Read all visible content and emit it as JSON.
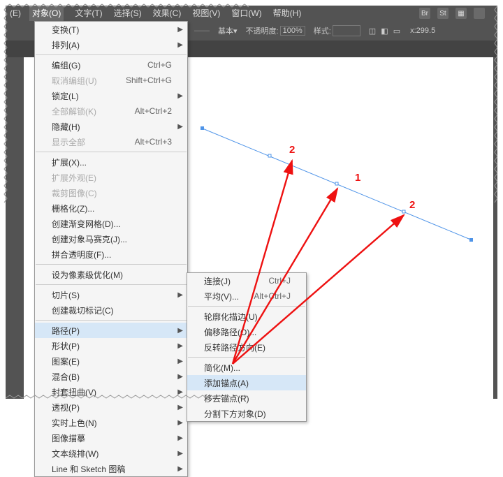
{
  "menubar": {
    "items": [
      "(E)",
      "对象(O)",
      "文字(T)",
      "选择(S)",
      "效果(C)",
      "视图(V)",
      "窗口(W)",
      "帮助(H)"
    ]
  },
  "toolbar": {
    "basic": "基本",
    "opacity_label": "不透明度:",
    "opacity_value": "100%",
    "style_label": "样式:",
    "x_label": "x:",
    "x_value": "299.5"
  },
  "tab": {
    "doc_label": ""
  },
  "object_menu": {
    "items": [
      {
        "label": "变换(T)",
        "sub": true
      },
      {
        "label": "排列(A)",
        "sub": true
      },
      "sep",
      {
        "label": "编组(G)",
        "shortcut": "Ctrl+G"
      },
      {
        "label": "取消编组(U)",
        "shortcut": "Shift+Ctrl+G",
        "disabled": true
      },
      {
        "label": "锁定(L)",
        "sub": true
      },
      {
        "label": "全部解锁(K)",
        "shortcut": "Alt+Ctrl+2",
        "disabled": true
      },
      {
        "label": "隐藏(H)",
        "sub": true
      },
      {
        "label": "显示全部",
        "shortcut": "Alt+Ctrl+3",
        "disabled": true
      },
      "sep",
      {
        "label": "扩展(X)..."
      },
      {
        "label": "扩展外观(E)",
        "disabled": true
      },
      {
        "label": "裁剪图像(C)",
        "disabled": true
      },
      {
        "label": "栅格化(Z)..."
      },
      {
        "label": "创建渐变网格(D)..."
      },
      {
        "label": "创建对象马赛克(J)..."
      },
      {
        "label": "拼合透明度(F)..."
      },
      "sep",
      {
        "label": "设为像素级优化(M)"
      },
      "sep",
      {
        "label": "切片(S)",
        "sub": true
      },
      {
        "label": "创建裁切标记(C)"
      },
      "sep",
      {
        "label": "路径(P)",
        "sub": true,
        "highlight": true
      },
      {
        "label": "形状(P)",
        "sub": true
      },
      {
        "label": "图案(E)",
        "sub": true
      },
      {
        "label": "混合(B)",
        "sub": true
      },
      {
        "label": "封套扭曲(V)",
        "sub": true
      },
      {
        "label": "透视(P)",
        "sub": true
      },
      {
        "label": "实时上色(N)",
        "sub": true
      },
      {
        "label": "图像描摹",
        "sub": true
      },
      {
        "label": "文本绕排(W)",
        "sub": true
      },
      {
        "label": "Line 和 Sketch 图稿",
        "sub": true
      }
    ]
  },
  "path_menu": {
    "items": [
      {
        "label": "连接(J)",
        "shortcut": "Ctrl+J"
      },
      {
        "label": "平均(V)...",
        "shortcut": "Alt+Ctrl+J"
      },
      "sep",
      {
        "label": "轮廓化描边(U)"
      },
      {
        "label": "偏移路径(O)..."
      },
      {
        "label": "反转路径方向(E)"
      },
      "sep",
      {
        "label": "简化(M)..."
      },
      {
        "label": "添加锚点(A)",
        "highlight": true
      },
      {
        "label": "移去锚点(R)"
      },
      {
        "label": "分割下方对象(D)"
      }
    ]
  },
  "canvas": {
    "labels": [
      "2",
      "1",
      "2"
    ]
  }
}
